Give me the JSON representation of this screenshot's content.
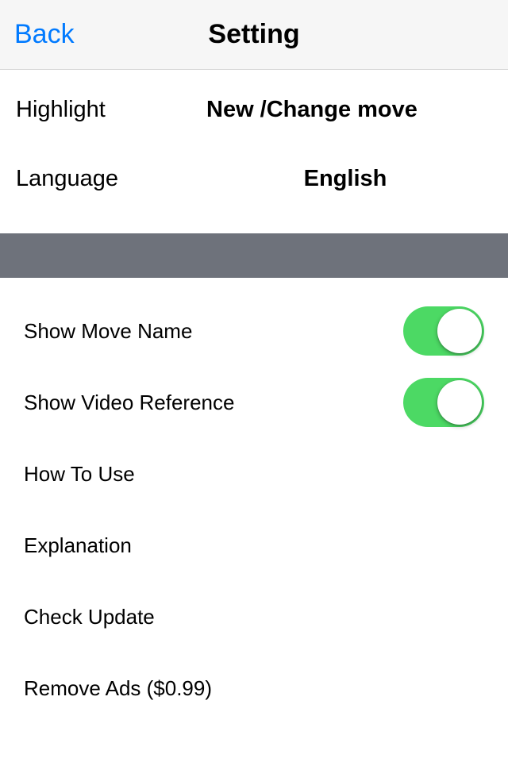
{
  "nav": {
    "back_label": "Back",
    "title": "Setting"
  },
  "top": {
    "highlight_label": "Highlight",
    "highlight_value": "New /Change move",
    "language_label": "Language",
    "language_value": "English"
  },
  "options": {
    "show_move_name": "Show Move Name",
    "show_video_reference": "Show Video Reference",
    "how_to_use": "How To Use",
    "explanation": "Explanation",
    "check_update": "Check Update",
    "remove_ads": "Remove Ads ($0.99)"
  }
}
